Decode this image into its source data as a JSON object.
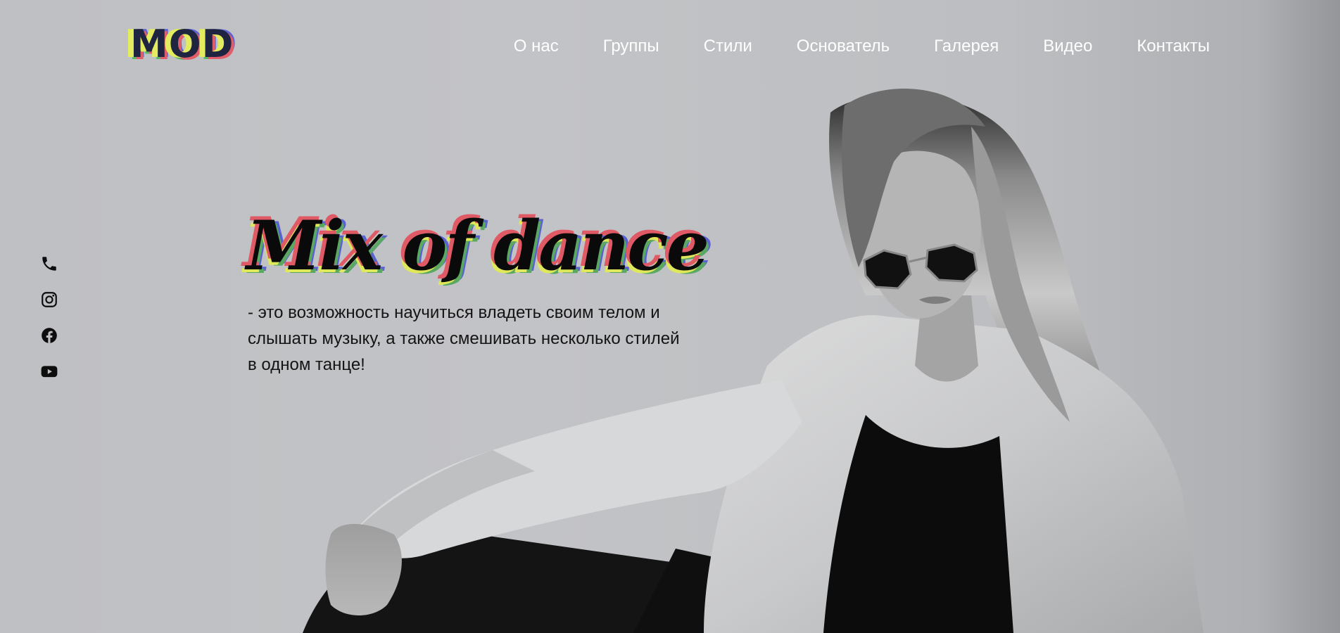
{
  "logo": {
    "text": "MOD"
  },
  "nav": {
    "items": [
      {
        "label": "О нас"
      },
      {
        "label": "Группы"
      },
      {
        "label": "Стили"
      },
      {
        "label": "Основатель"
      },
      {
        "label": "Галерея"
      },
      {
        "label": "Видео"
      },
      {
        "label": "Контакты"
      }
    ]
  },
  "hero": {
    "title": "Mix of dance",
    "description": "- это возможность научиться владеть своим телом и слышать музыку, а также смешивать несколько стилей в одном танце!"
  },
  "social": {
    "icons": [
      "phone-icon",
      "instagram-icon",
      "facebook-icon",
      "youtube-icon"
    ]
  },
  "colors": {
    "nav_text": "#ffffff",
    "logo_text": "#1f2540",
    "accent_yellow": "#dfe85a",
    "accent_red": "#e05a66",
    "accent_green": "#5aa862",
    "accent_blue": "#5a62cf"
  }
}
